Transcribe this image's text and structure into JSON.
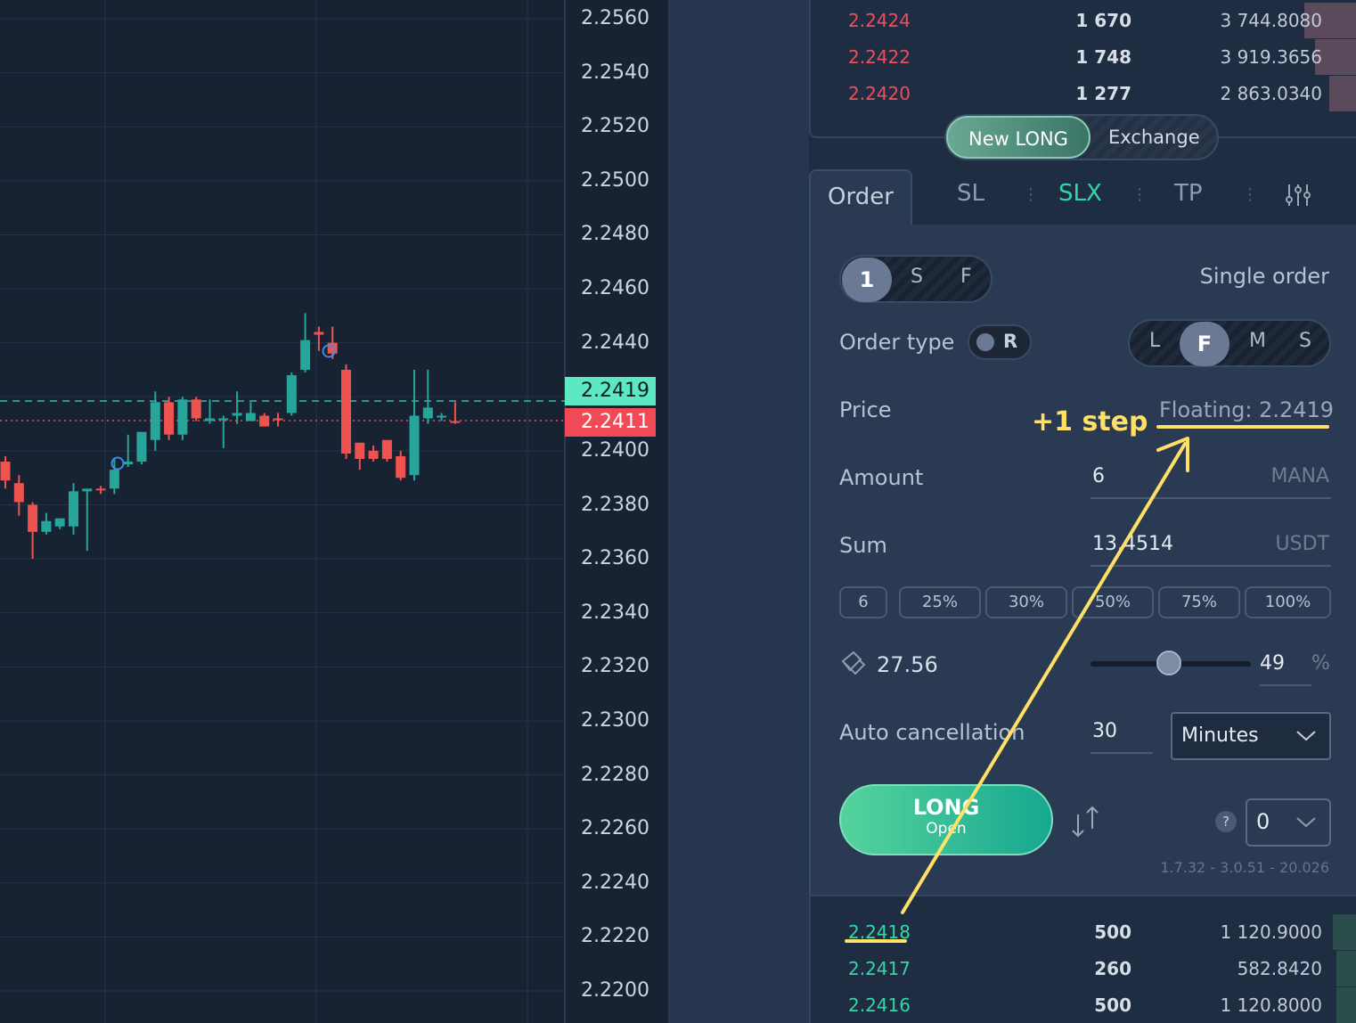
{
  "chart": {
    "price_axis": [
      "2.2560",
      "2.2540",
      "2.2520",
      "2.2500",
      "2.2480",
      "2.2460",
      "2.2440",
      "2.2419",
      "2.2411",
      "2.2400",
      "2.2380",
      "2.2360",
      "2.2340",
      "2.2320",
      "2.2300",
      "2.2280",
      "2.2260",
      "2.2240",
      "2.2220",
      "2.2200"
    ],
    "current_ask_tag": "2.2419",
    "current_bid_tag": "2.2411",
    "candles": [
      {
        "o": 2.2396,
        "h": 2.2398,
        "l": 2.2386,
        "c": 2.2389,
        "dir": "down"
      },
      {
        "o": 2.2388,
        "h": 2.2391,
        "l": 2.2376,
        "c": 2.2381,
        "dir": "down"
      },
      {
        "o": 2.238,
        "h": 2.2381,
        "l": 2.236,
        "c": 2.237,
        "dir": "down"
      },
      {
        "o": 2.237,
        "h": 2.2377,
        "l": 2.2369,
        "c": 2.2374,
        "dir": "up"
      },
      {
        "o": 2.2372,
        "h": 2.2375,
        "l": 2.2371,
        "c": 2.2375,
        "dir": "up"
      },
      {
        "o": 2.2372,
        "h": 2.2388,
        "l": 2.2369,
        "c": 2.2385,
        "dir": "up"
      },
      {
        "o": 2.2385,
        "h": 2.2386,
        "l": 2.2363,
        "c": 2.2386,
        "dir": "up"
      },
      {
        "o": 2.2386,
        "h": 2.2387,
        "l": 2.2384,
        "c": 2.2386,
        "dir": "down"
      },
      {
        "o": 2.2386,
        "h": 2.2397,
        "l": 2.2384,
        "c": 2.2393,
        "dir": "up"
      },
      {
        "o": 2.2395,
        "h": 2.2406,
        "l": 2.2394,
        "c": 2.2396,
        "dir": "up"
      },
      {
        "o": 2.2396,
        "h": 2.24,
        "l": 2.2395,
        "c": 2.2407,
        "dir": "up"
      },
      {
        "o": 2.2404,
        "h": 2.2422,
        "l": 2.24,
        "c": 2.2418,
        "dir": "up"
      },
      {
        "o": 2.2418,
        "h": 2.242,
        "l": 2.2404,
        "c": 2.2406,
        "dir": "down"
      },
      {
        "o": 2.2406,
        "h": 2.242,
        "l": 2.2404,
        "c": 2.2419,
        "dir": "up"
      },
      {
        "o": 2.2419,
        "h": 2.242,
        "l": 2.2411,
        "c": 2.2412,
        "dir": "down"
      },
      {
        "o": 2.2411,
        "h": 2.2419,
        "l": 2.241,
        "c": 2.2412,
        "dir": "up"
      },
      {
        "o": 2.2412,
        "h": 2.2413,
        "l": 2.2401,
        "c": 2.2412,
        "dir": "up"
      },
      {
        "o": 2.2413,
        "h": 2.2422,
        "l": 2.241,
        "c": 2.2414,
        "dir": "up"
      },
      {
        "o": 2.2414,
        "h": 2.2418,
        "l": 2.2411,
        "c": 2.2411,
        "dir": "up"
      },
      {
        "o": 2.2413,
        "h": 2.2414,
        "l": 2.241,
        "c": 2.2409,
        "dir": "down"
      },
      {
        "o": 2.2412,
        "h": 2.2414,
        "l": 2.2409,
        "c": 2.2412,
        "dir": "down"
      },
      {
        "o": 2.2414,
        "h": 2.2429,
        "l": 2.2413,
        "c": 2.2428,
        "dir": "up"
      },
      {
        "o": 2.243,
        "h": 2.2451,
        "l": 2.2429,
        "c": 2.2441,
        "dir": "up"
      },
      {
        "o": 2.2444,
        "h": 2.2446,
        "l": 2.2437,
        "c": 2.2443,
        "dir": "down"
      },
      {
        "o": 2.244,
        "h": 2.2446,
        "l": 2.2434,
        "c": 2.2436,
        "dir": "down"
      },
      {
        "o": 2.243,
        "h": 2.2432,
        "l": 2.2397,
        "c": 2.2399,
        "dir": "down"
      },
      {
        "o": 2.2403,
        "h": 2.2403,
        "l": 2.2393,
        "c": 2.2397,
        "dir": "down"
      },
      {
        "o": 2.24,
        "h": 2.2402,
        "l": 2.2396,
        "c": 2.2397,
        "dir": "down"
      },
      {
        "o": 2.2404,
        "h": 2.2404,
        "l": 2.2396,
        "c": 2.2397,
        "dir": "down"
      },
      {
        "o": 2.2398,
        "h": 2.24,
        "l": 2.2389,
        "c": 2.239,
        "dir": "down"
      },
      {
        "o": 2.2391,
        "h": 2.243,
        "l": 2.2389,
        "c": 2.2413,
        "dir": "up"
      },
      {
        "o": 2.2412,
        "h": 2.243,
        "l": 2.241,
        "c": 2.2416,
        "dir": "up"
      },
      {
        "o": 2.2413,
        "h": 2.2414,
        "l": 2.2411,
        "c": 2.2413,
        "dir": "up"
      },
      {
        "o": 2.2411,
        "h": 2.2418,
        "l": 2.241,
        "c": 2.2411,
        "dir": "down"
      }
    ]
  },
  "ask_book": [
    {
      "price": "2.2424",
      "amount": "1 670",
      "total": "3 744.8080",
      "depth": 0.75
    },
    {
      "price": "2.2422",
      "amount": "1 748",
      "total": "3 919.3656",
      "depth": 0.6
    },
    {
      "price": "2.2420",
      "amount": "1 277",
      "total": "2 863.0340",
      "depth": 0.4
    }
  ],
  "bid_book": [
    {
      "price": "2.2418",
      "amount": "500",
      "total": "1 120.9000",
      "depth": 0.35
    },
    {
      "price": "2.2417",
      "amount": "260",
      "total": "582.8420",
      "depth": 0.3
    },
    {
      "price": "2.2416",
      "amount": "500",
      "total": "1 120.8000",
      "depth": 0.3
    }
  ],
  "mode": {
    "new_long": "New LONG",
    "exchange": "Exchange"
  },
  "tabs": {
    "order": "Order",
    "sl": "SL",
    "slx": "SLX",
    "tp": "TP"
  },
  "form": {
    "count_options": {
      "one": "1",
      "s": "S",
      "f": "F"
    },
    "single_order": "Single order",
    "order_type_label": "Order type",
    "order_type_r": "R",
    "order_modes": {
      "l": "L",
      "f": "F",
      "m": "M",
      "s": "S"
    },
    "price_label": "Price",
    "price_floating": "Floating: 2.2419",
    "amount_label": "Amount",
    "amount_value": "6",
    "amount_unit": "MANA",
    "sum_label": "Sum",
    "sum_value": "13.4514",
    "sum_unit": "USDT",
    "percent_buttons": [
      "6",
      "25%",
      "30%",
      "50%",
      "75%",
      "100%"
    ],
    "balance": "27.56",
    "slider_value": "49",
    "slider_pct": 0.49,
    "slider_unit": "%",
    "auto_cancel_label": "Auto cancellation",
    "auto_cancel_value": "30",
    "auto_cancel_unit": "Minutes",
    "long_label": "LONG",
    "long_sub": "Open",
    "help": "?",
    "qty_value": "0",
    "version": "1.7.32 - 3.0.51 - 20.026"
  },
  "annotation": {
    "step": "+1 step"
  },
  "colors": {
    "up": "#26a69a",
    "down": "#ef5350",
    "accent": "#34d6a8",
    "annotation": "#ffe066"
  }
}
